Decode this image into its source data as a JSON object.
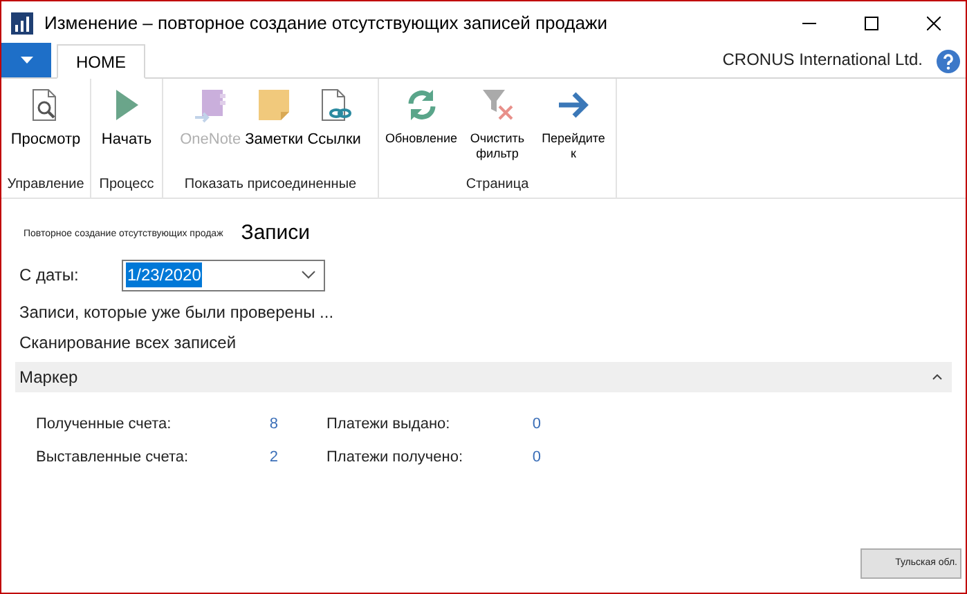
{
  "window": {
    "title": "Изменение – повторное создание отсутствующих записей продажи"
  },
  "tabs": [
    {
      "label": "HOME",
      "selected": true
    }
  ],
  "company": "CRONUS International Ltd.",
  "ribbon": [
    {
      "label": "Управление",
      "items": [
        {
          "label": "Просмотр",
          "disabled": false
        }
      ]
    },
    {
      "label": "Процесс",
      "items": [
        {
          "label": "Начать",
          "disabled": false
        }
      ]
    },
    {
      "label": "Показать присоединенные",
      "items": [
        {
          "label": "OneNote",
          "disabled": true
        },
        {
          "label": "Заметки",
          "disabled": false
        },
        {
          "label": "Ссылки",
          "disabled": false
        }
      ]
    },
    {
      "label": "Страница",
      "items": [
        {
          "label": "Обновление",
          "disabled": false
        },
        {
          "label": "Очистить фильтр",
          "disabled": false
        },
        {
          "label": "Перейдите к",
          "disabled": false
        }
      ]
    }
  ],
  "page": {
    "subtitle": "Повторное создание отсутствующих продаж",
    "title": "Записи"
  },
  "date_field": {
    "label": "С даты:",
    "value": "1/23/2020"
  },
  "messages": [
    "Записи, которые уже были проверены ...",
    "Сканирование всех записей"
  ],
  "section": {
    "title": "Маркер",
    "expanded": true,
    "stats": [
      {
        "label": "Полученные счета:",
        "value": "8"
      },
      {
        "label": "Платежи выдано:",
        "value": "0"
      },
      {
        "label": "Выставленные счета:",
        "value": "2"
      },
      {
        "label": "Платежи получено:",
        "value": "0"
      }
    ]
  },
  "footer_button": "Тульская обл."
}
